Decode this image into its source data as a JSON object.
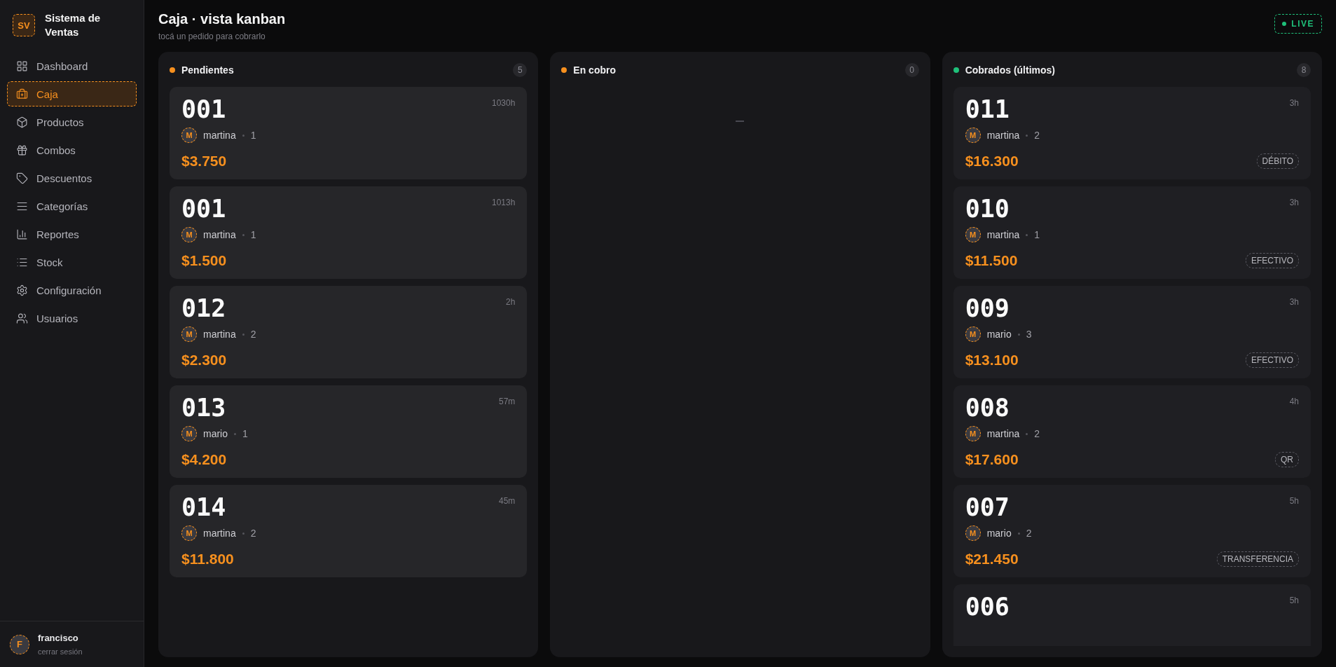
{
  "brand": {
    "initials": "SV",
    "name": "Sistema de Ventas"
  },
  "nav": [
    {
      "label": "Dashboard",
      "selected": false
    },
    {
      "label": "Caja",
      "selected": true
    },
    {
      "label": "Productos",
      "selected": false
    },
    {
      "label": "Combos",
      "selected": false
    },
    {
      "label": "Descuentos",
      "selected": false
    },
    {
      "label": "Categorías",
      "selected": false
    },
    {
      "label": "Reportes",
      "selected": false
    },
    {
      "label": "Stock",
      "selected": false
    },
    {
      "label": "Configuración",
      "selected": false
    },
    {
      "label": "Usuarios",
      "selected": false
    }
  ],
  "user": {
    "initial": "F",
    "name": "francisco",
    "logout": "cerrar sesión"
  },
  "header": {
    "title": "Caja · vista kanban",
    "subtitle": "tocá un pedido para cobrarlo",
    "live": "LIVE"
  },
  "columns": [
    {
      "title": "Pendientes",
      "count": "5",
      "color": "#f7901e",
      "cards": [
        {
          "number": "001",
          "age": "1030h",
          "initial": "M",
          "waiter": "martina",
          "items": "1",
          "total": "$3.750"
        },
        {
          "number": "001",
          "age": "1013h",
          "initial": "M",
          "waiter": "martina",
          "items": "1",
          "total": "$1.500"
        },
        {
          "number": "012",
          "age": "2h",
          "initial": "M",
          "waiter": "martina",
          "items": "2",
          "total": "$2.300"
        },
        {
          "number": "013",
          "age": "57m",
          "initial": "M",
          "waiter": "mario",
          "items": "1",
          "total": "$4.200"
        },
        {
          "number": "014",
          "age": "45m",
          "initial": "M",
          "waiter": "martina",
          "items": "2",
          "total": "$11.800"
        }
      ]
    },
    {
      "title": "En cobro",
      "count": "0",
      "color": "#f7901e"
    },
    {
      "title": "Cobrados (últimos)",
      "count": "8",
      "color": "#1fc07a",
      "cards": [
        {
          "number": "011",
          "age": "3h",
          "initial": "M",
          "waiter": "martina",
          "items": "2",
          "total": "$16.300",
          "method": "DÉBITO"
        },
        {
          "number": "010",
          "age": "3h",
          "initial": "M",
          "waiter": "martina",
          "items": "1",
          "total": "$11.500",
          "method": "EFECTIVO"
        },
        {
          "number": "009",
          "age": "3h",
          "initial": "M",
          "waiter": "mario",
          "items": "3",
          "total": "$13.100",
          "method": "EFECTIVO"
        },
        {
          "number": "008",
          "age": "4h",
          "initial": "M",
          "waiter": "martina",
          "items": "2",
          "total": "$17.600",
          "method": "QR"
        },
        {
          "number": "007",
          "age": "5h",
          "initial": "M",
          "waiter": "mario",
          "items": "2",
          "total": "$21.450",
          "method": "TRANSFERENCIA"
        },
        {
          "number": "006",
          "age": "5h"
        }
      ]
    }
  ]
}
